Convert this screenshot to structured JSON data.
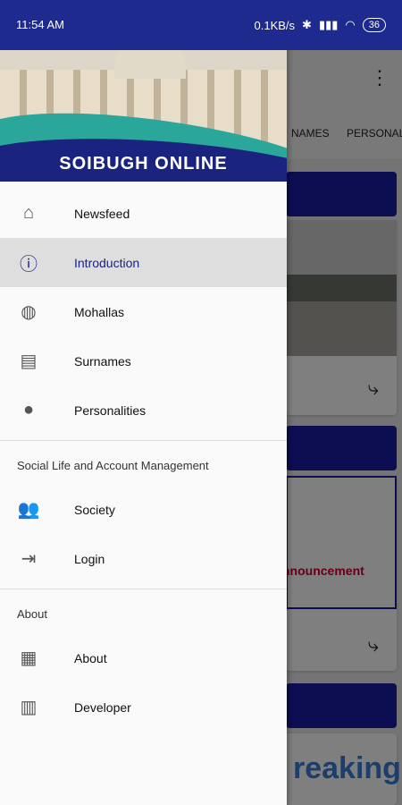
{
  "status_bar": {
    "time": "11:54 AM",
    "net_speed": "0.1KB/s",
    "battery": "36"
  },
  "drawer": {
    "brand": "SOIBUGH ONLINE",
    "primary_items": [
      {
        "label": "Newsfeed",
        "icon": "home-icon"
      },
      {
        "label": "Introduction",
        "icon": "info-icon"
      },
      {
        "label": "Mohallas",
        "icon": "globe-icon"
      },
      {
        "label": "Surnames",
        "icon": "message-icon"
      },
      {
        "label": "Personalities",
        "icon": "person-icon"
      }
    ],
    "section_social": "Social Life and Account Management",
    "social_items": [
      {
        "label": "Society",
        "icon": "group-icon"
      },
      {
        "label": "Login",
        "icon": "login-icon"
      }
    ],
    "section_about": "About",
    "about_items": [
      {
        "label": "About",
        "icon": "clapperboard-icon"
      },
      {
        "label": "Developer",
        "icon": "building-icon"
      }
    ]
  },
  "background_app": {
    "tabs": [
      "NAMES",
      "PERSONALI"
    ],
    "announcement_text": "nnouncement",
    "breaking_text": "reaking"
  },
  "colors": {
    "primary": "#1a237e",
    "accent_teal": "#2aa79a",
    "active_bg": "#dedede"
  }
}
